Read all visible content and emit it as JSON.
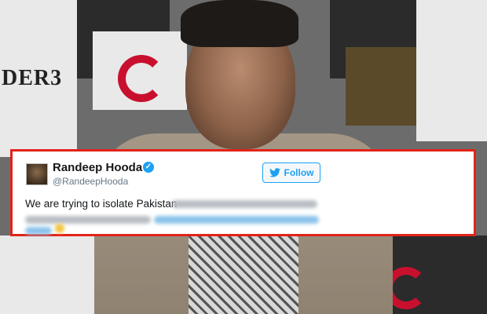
{
  "tweet": {
    "name": "Randeep Hooda",
    "handle": "@RandeepHooda",
    "follow_label": "Follow",
    "text_visible": "We are trying to isolate Pakistan"
  },
  "backdrop": {
    "logo_fragment": "DER3"
  },
  "colors": {
    "frame": "#e2231a",
    "twitter_blue": "#1da1f2",
    "verified": "#1da1f2"
  },
  "icons": {
    "verified": "verified-badge-icon",
    "follow": "twitter-bird-icon"
  }
}
